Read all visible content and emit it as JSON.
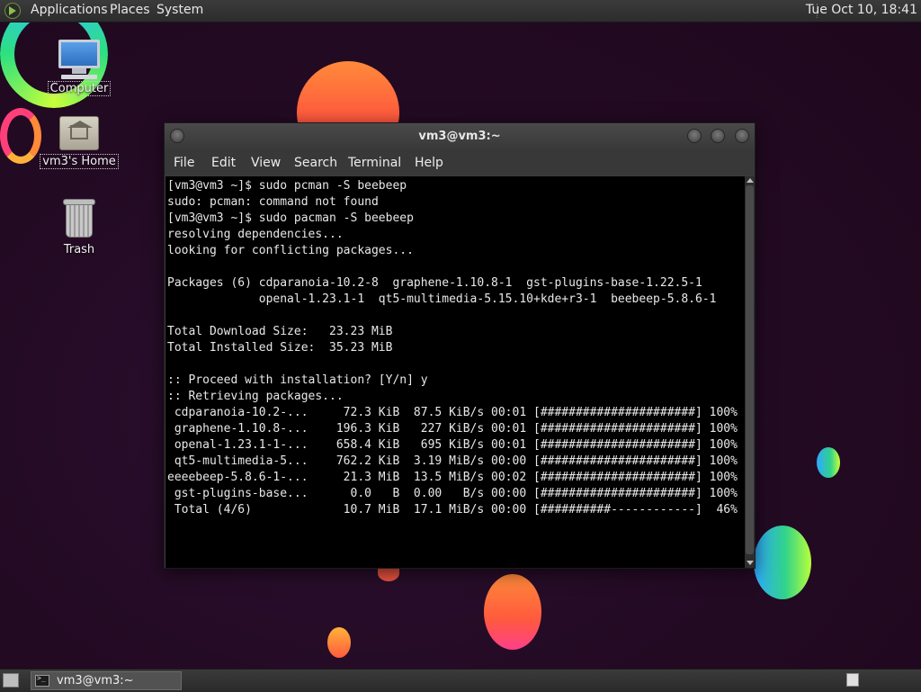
{
  "top_panel": {
    "menus": [
      "Applications",
      "Places",
      "System"
    ],
    "clock": "Tue Oct 10, 18:41"
  },
  "desktop_icons": [
    {
      "label": "Computer",
      "icon": "computer-icon"
    },
    {
      "label": "vm3's Home",
      "icon": "home-folder-icon"
    },
    {
      "label": "Trash",
      "icon": "trash-icon"
    }
  ],
  "window": {
    "title": "vm3@vm3:~",
    "menu": [
      "File",
      "Edit",
      "View",
      "Search",
      "Terminal",
      "Help"
    ],
    "terminal_lines": [
      "[vm3@vm3 ~]$ sudo pcman -S beebeep",
      "sudo: pcman: command not found",
      "[vm3@vm3 ~]$ sudo pacman -S beebeep",
      "resolving dependencies...",
      "looking for conflicting packages...",
      "",
      "Packages (6) cdparanoia-10.2-8  graphene-1.10.8-1  gst-plugins-base-1.22.5-1",
      "             openal-1.23.1-1  qt5-multimedia-5.15.10+kde+r3-1  beebeep-5.8.6-1",
      "",
      "Total Download Size:   23.23 MiB",
      "Total Installed Size:  35.23 MiB",
      "",
      ":: Proceed with installation? [Y/n] y",
      ":: Retrieving packages...",
      " cdparanoia-10.2-...     72.3 KiB  87.5 KiB/s 00:01 [######################] 100%",
      " graphene-1.10.8-...    196.3 KiB   227 KiB/s 00:01 [######################] 100%",
      " openal-1.23.1-1-...    658.4 KiB   695 KiB/s 00:01 [######################] 100%",
      " qt5-multimedia-5...    762.2 KiB  3.19 MiB/s 00:00 [######################] 100%",
      "eeeebeep-5.8.6-1-...     21.3 MiB  13.5 MiB/s 00:02 [######################] 100%",
      " gst-plugins-base...      0.0   B  0.00   B/s 00:00 [######################] 100%",
      " Total (4/6)             10.7 MiB  17.1 MiB/s 00:00 [##########------------]  46%"
    ]
  },
  "taskbar": {
    "items": [
      {
        "label": "vm3@vm3:~",
        "icon": "terminal-icon"
      }
    ]
  },
  "colors": {
    "panel": "#333333",
    "terminal_bg": "#000000",
    "terminal_fg": "#e8e8e8",
    "desktop_bg": "#240b24"
  }
}
